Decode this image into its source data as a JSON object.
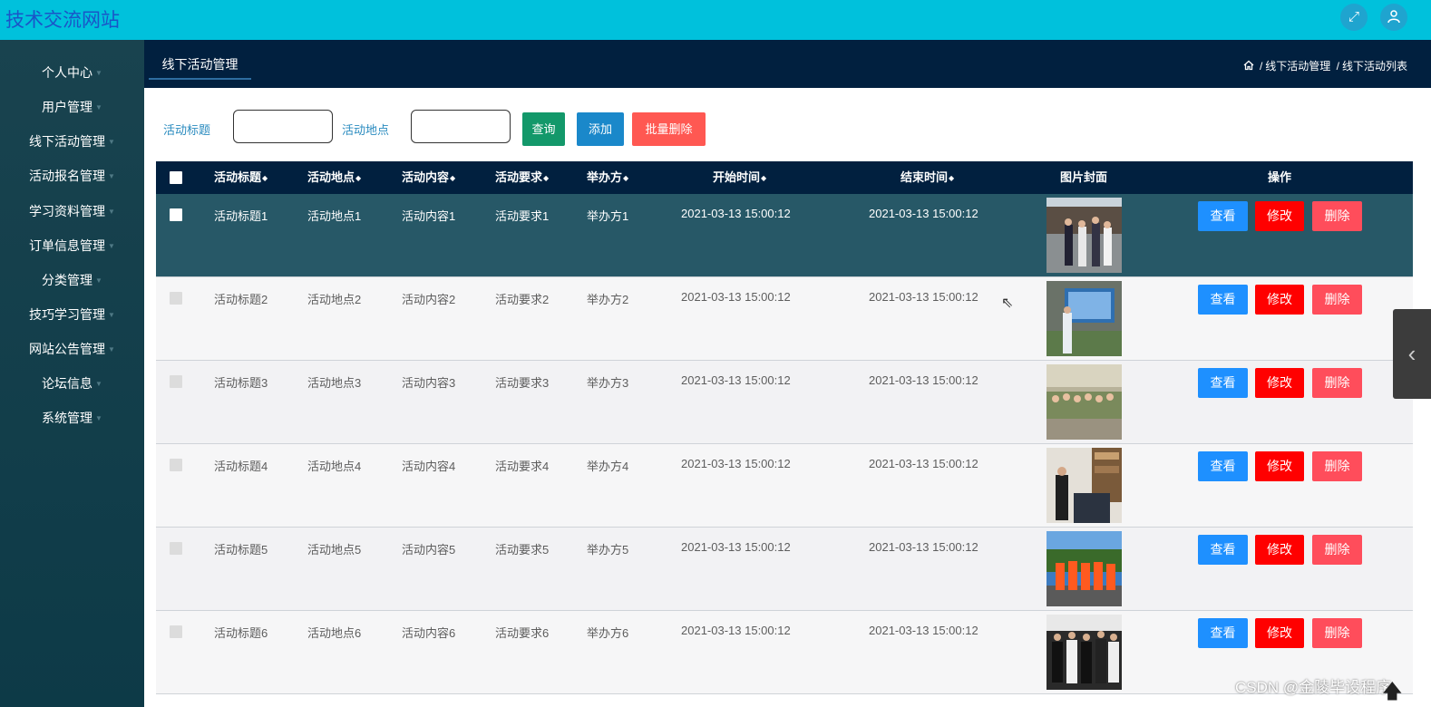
{
  "header": {
    "site_title": "技术交流网站",
    "fullscreen_icon": "fullscreen-icon",
    "user_icon": "user-icon"
  },
  "sidebar": {
    "items": [
      {
        "label": "个人中心"
      },
      {
        "label": "用户管理"
      },
      {
        "label": "线下活动管理"
      },
      {
        "label": "活动报名管理"
      },
      {
        "label": "学习资料管理"
      },
      {
        "label": "订单信息管理"
      },
      {
        "label": "分类管理"
      },
      {
        "label": "技巧学习管理"
      },
      {
        "label": "网站公告管理"
      },
      {
        "label": "论坛信息"
      },
      {
        "label": "系统管理"
      }
    ]
  },
  "subbar": {
    "tab": "线下活动管理",
    "breadcrumb": [
      "线下活动管理",
      "线下活动列表"
    ]
  },
  "search": {
    "title_label": "活动标题",
    "title_value": "",
    "location_label": "活动地点",
    "location_value": "",
    "query_button": "查询",
    "add_button": "添加",
    "batch_delete_button": "批量删除"
  },
  "table": {
    "headers": [
      "活动标题",
      "活动地点",
      "活动内容",
      "活动要求",
      "举办方",
      "开始时间",
      "结束时间",
      "图片封面",
      "操作"
    ],
    "rows": [
      {
        "title": "活动标题1",
        "location": "活动地点1",
        "content": "活动内容1",
        "requirement": "活动要求1",
        "organizer": "举办方1",
        "start": "2021-03-13 15:00:12",
        "end": "2021-03-13 15:00:12"
      },
      {
        "title": "活动标题2",
        "location": "活动地点2",
        "content": "活动内容2",
        "requirement": "活动要求2",
        "organizer": "举办方2",
        "start": "2021-03-13 15:00:12",
        "end": "2021-03-13 15:00:12"
      },
      {
        "title": "活动标题3",
        "location": "活动地点3",
        "content": "活动内容3",
        "requirement": "活动要求3",
        "organizer": "举办方3",
        "start": "2021-03-13 15:00:12",
        "end": "2021-03-13 15:00:12"
      },
      {
        "title": "活动标题4",
        "location": "活动地点4",
        "content": "活动内容4",
        "requirement": "活动要求4",
        "organizer": "举办方4",
        "start": "2021-03-13 15:00:12",
        "end": "2021-03-13 15:00:12"
      },
      {
        "title": "活动标题5",
        "location": "活动地点5",
        "content": "活动内容5",
        "requirement": "活动要求5",
        "organizer": "举办方5",
        "start": "2021-03-13 15:00:12",
        "end": "2021-03-13 15:00:12"
      },
      {
        "title": "活动标题6",
        "location": "活动地点6",
        "content": "活动内容6",
        "requirement": "活动要求6",
        "organizer": "举办方6",
        "start": "2021-03-13 15:00:12",
        "end": "2021-03-13 15:00:12"
      }
    ],
    "actions": {
      "view": "查看",
      "edit": "修改",
      "delete": "删除"
    }
  },
  "watermark": "CSDN @金陵毕设程序",
  "colors": {
    "topbar": "#00c1dc",
    "sidebar": "#0d3a47",
    "subbar": "#01203f",
    "table_header": "#01203f",
    "active_row": "#275867",
    "view_button": "#1e90ff",
    "edit_button": "#ff0000",
    "delete_button": "#ff4d5b"
  }
}
